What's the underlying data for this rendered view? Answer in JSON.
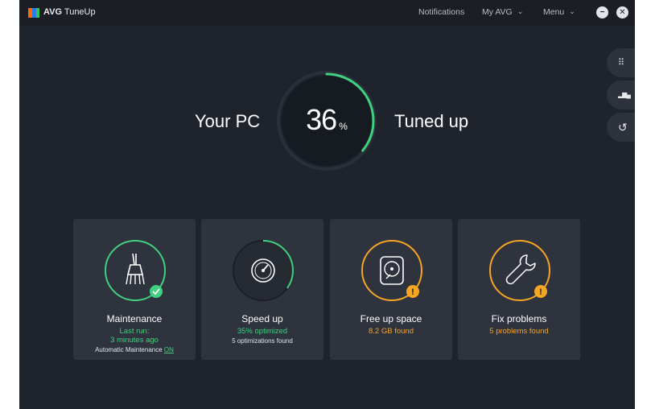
{
  "app": {
    "brand_bold": "AVG",
    "brand_name": "TuneUp"
  },
  "nav": {
    "notifications": "Notifications",
    "my_avg": "My AVG",
    "menu": "Menu"
  },
  "window_controls": {
    "minimize": "−",
    "close": "✕"
  },
  "hero": {
    "left_label": "Your PC",
    "right_label": "Tuned up",
    "percent": "36",
    "percent_unit": "%",
    "progress": 0.36
  },
  "side_buttons": [
    {
      "icon": "grid-icon",
      "glyph": "⠿"
    },
    {
      "icon": "chart-icon",
      "glyph": "▂▆▄"
    },
    {
      "icon": "undo-icon",
      "glyph": "↺"
    }
  ],
  "cards": [
    {
      "title": "Maintenance",
      "sub1": "Last run:",
      "sub2": "3 minutes ago",
      "note": "Automatic Maintenance",
      "note_link": "ON",
      "status_color": "#3fd17f",
      "badge": "✓"
    },
    {
      "title": "Speed up",
      "sub1": "35% optimized",
      "note": "5 optimizations found",
      "progress": 0.35,
      "status_color": "#3fd17f"
    },
    {
      "title": "Free up space",
      "sub1": "8.2 GB found",
      "status_color": "#f5a623",
      "badge": "!"
    },
    {
      "title": "Fix problems",
      "sub1": "5 problems found",
      "status_color": "#f5a623",
      "badge": "!"
    }
  ],
  "colors": {
    "accent_green": "#3fd17f",
    "accent_orange": "#f5a623",
    "background": "#1f232c",
    "card": "#2e333e"
  }
}
